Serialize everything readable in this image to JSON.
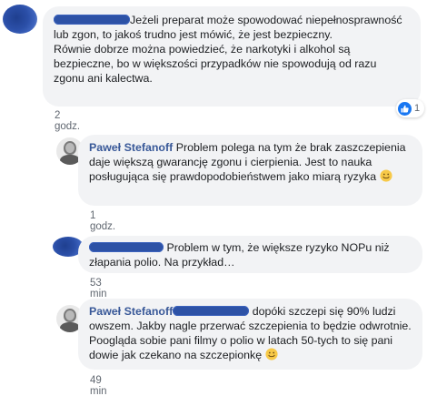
{
  "comments": [
    {
      "author": "",
      "text": "Jeżeli preparat może spowodować niepełnosprawność lub zgon, to jakoś trudno jest mówić, że jest bezpieczny.",
      "text2": "Równie dobrze można powiedzieć, że narkotyki i alkohol są bezpieczne, bo w większości przypadków nie spowodują od razu zgonu ani kalectwa.",
      "time": "2 godz.",
      "reaction_count": "1",
      "reaction_icon": "like-icon"
    },
    {
      "author": "Paweł Stefanoff",
      "text": "Problem polega na tym że brak zaszczepienia daje większą gwarancję zgonu i cierpienia. Jest to nauka posługująca się prawdopodobieństwem jako miarą ryzyka",
      "emoji": "smiley-icon",
      "time": "1 godz."
    },
    {
      "author": "",
      "text": "Problem w tym, że większe ryzyko NOPu niż złapania polio. Na przykład…",
      "time": "53 min"
    },
    {
      "author": "Paweł Stefanoff",
      "text": "dopóki szczepi się 90% ludzi owszem. Jakby nagle przerwać szczepienia to będzie odwrotnie. Poogląda sobie pani filmy o polio w latach 50-tych to się pani dowie jak czekano na szczepionkę",
      "emoji": "smiley-icon",
      "time": "49 min"
    }
  ],
  "colors": {
    "bubble": "#f2f3f5",
    "author": "#385898",
    "meta": "#606770",
    "like": "#1877f2"
  }
}
